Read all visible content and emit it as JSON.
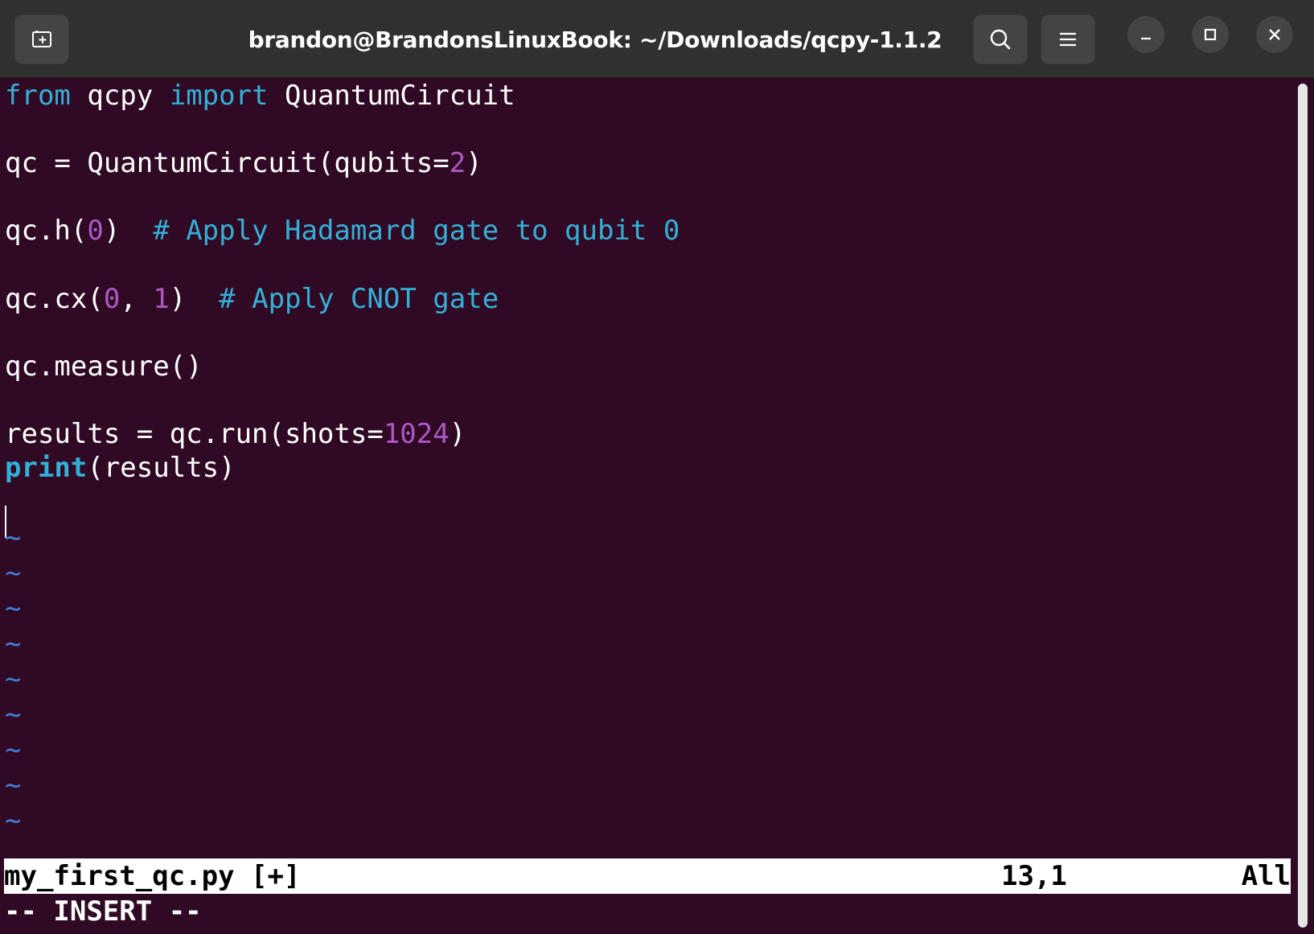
{
  "window": {
    "title": "brandon@BrandonsLinuxBook: ~/Downloads/qcpy-1.1.2"
  },
  "titlebar_icons": [
    "new-tab-icon",
    "search-icon",
    "hamburger-menu-icon",
    "minimize-icon",
    "maximize-icon",
    "close-icon"
  ],
  "colors": {
    "terminal_bg": "#300a24",
    "keyword": "#34b0d6",
    "number": "#ad57c3",
    "tilde": "#3f7fd8"
  },
  "code": {
    "line1": {
      "kw1": "from",
      "t1": " qcpy ",
      "kw2": "import",
      "t2": " QuantumCircuit"
    },
    "line3": {
      "t1": "qc = QuantumCircuit(qubits=",
      "num": "2",
      "t2": ")"
    },
    "line5": {
      "t1": "qc.h(",
      "num": "0",
      "t2": ")  ",
      "comment": "# Apply Hadamard gate to qubit 0"
    },
    "line7": {
      "t1": "qc.cx(",
      "num1": "0",
      "t2": ", ",
      "num2": "1",
      "t3": ")  ",
      "comment": "# Apply CNOT gate"
    },
    "line9": {
      "t1": "qc.measure()"
    },
    "line11": {
      "t1": "results = qc.run(shots=",
      "num": "1024",
      "t2": ")"
    },
    "line12": {
      "fn": "print",
      "t1": "(results)"
    }
  },
  "empty_line_marker": "~",
  "status": {
    "filename": "my_first_qc.py [+]",
    "position": "13,1",
    "scroll": "All",
    "mode": "-- INSERT --"
  }
}
